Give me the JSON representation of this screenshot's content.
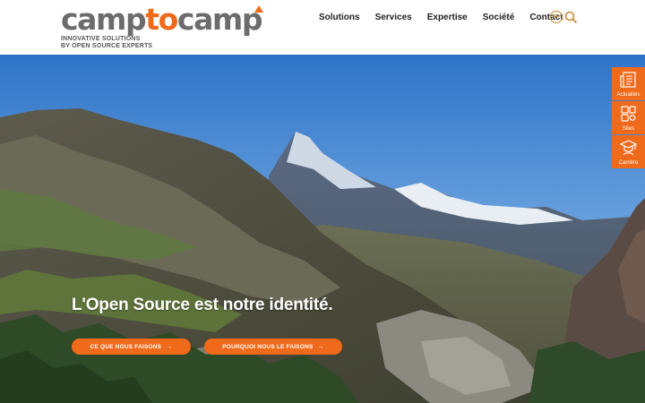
{
  "header": {
    "logo": {
      "part1": "camp",
      "part2": "to",
      "part3": "camp"
    },
    "tagline_line1": "INNOVATIVE SOLUTIONS",
    "tagline_line2": "BY OPEN SOURCE EXPERTS",
    "nav": [
      "Solutions",
      "Services",
      "Expertise",
      "Société",
      "Contact"
    ],
    "language": "FR",
    "search_icon": "search-icon"
  },
  "hero": {
    "headline": "L'Open Source est notre identité.",
    "button_primary": "CE QUE NOUS FAISONS",
    "button_secondary": "POURQUOI NOUS LE FAISONS"
  },
  "side_tabs": [
    {
      "label": "Actualités",
      "icon": "news-icon"
    },
    {
      "label": "Sites",
      "icon": "sites-icon"
    },
    {
      "label": "Carrière",
      "icon": "graduation-cap-icon"
    }
  ],
  "colors": {
    "accent": "#f06a1b",
    "logo_gray": "#6c6c6c",
    "lang_gold": "#c98a35"
  }
}
